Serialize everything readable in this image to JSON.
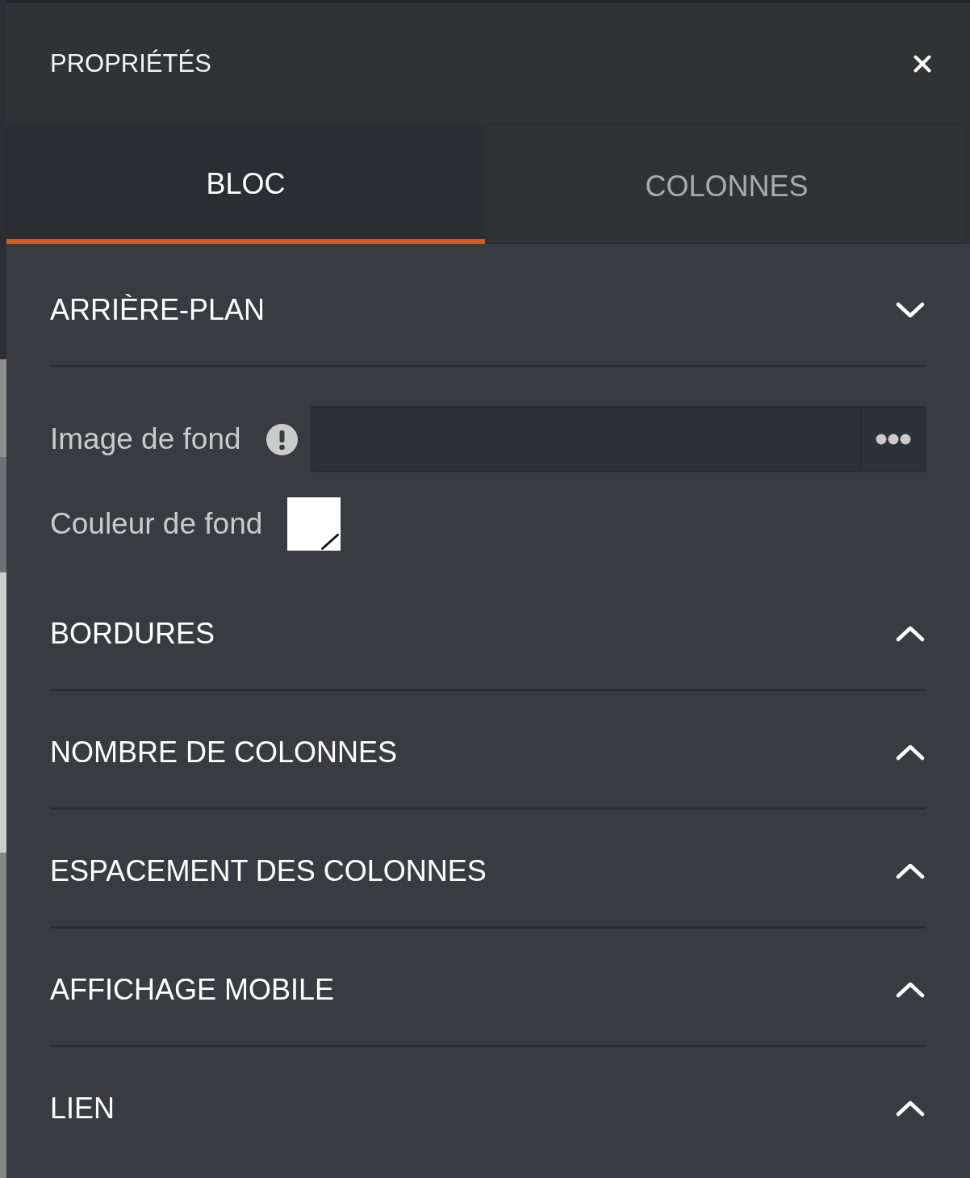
{
  "header": {
    "title": "PROPRIÉTÉS"
  },
  "tabs": [
    {
      "label": "BLOC",
      "selected": true
    },
    {
      "label": "COLONNES",
      "selected": false
    }
  ],
  "sections": [
    {
      "title": "ARRIÈRE-PLAN",
      "expanded": true,
      "fields": [
        {
          "kind": "file",
          "label": "Image de fond",
          "warning": true
        },
        {
          "kind": "color",
          "label": "Couleur de fond",
          "color": "#ffffff"
        }
      ]
    },
    {
      "title": "BORDURES",
      "expanded": false
    },
    {
      "title": "NOMBRE DE COLONNES",
      "expanded": false
    },
    {
      "title": "ESPACEMENT DES COLONNES",
      "expanded": false
    },
    {
      "title": "AFFICHAGE MOBILE",
      "expanded": false
    },
    {
      "title": "LIEN",
      "expanded": false
    }
  ]
}
